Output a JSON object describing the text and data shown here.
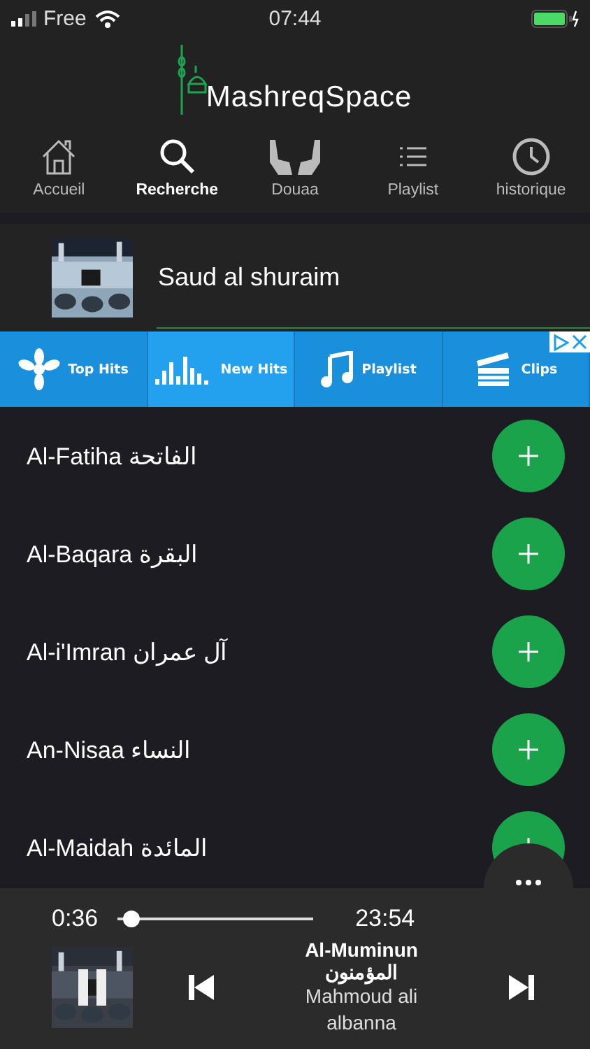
{
  "status_bar": {
    "carrier": "Free",
    "time": "07:44"
  },
  "logo": {
    "text": "MashreqSpace"
  },
  "nav": [
    {
      "label": "Accueil",
      "selected": false
    },
    {
      "label": "Recherche",
      "selected": true
    },
    {
      "label": "Douaa",
      "selected": false
    },
    {
      "label": "Playlist",
      "selected": false
    },
    {
      "label": "historique",
      "selected": false
    }
  ],
  "reciter": {
    "name": "Saud al shuraim"
  },
  "ad_banner": {
    "items": [
      {
        "label": "Top Hits",
        "selected": false
      },
      {
        "label": "New Hits",
        "selected": true
      },
      {
        "label": "Playlist",
        "selected": false
      },
      {
        "label": "Clips",
        "selected": false
      }
    ]
  },
  "surahs": [
    {
      "title": "Al-Fatiha الفاتحة"
    },
    {
      "title": "Al-Baqara البقرة"
    },
    {
      "title": "Al-i'Imran آل عمران"
    },
    {
      "title": "An-Nisaa النساء"
    },
    {
      "title": "Al-Maidah المائدة"
    }
  ],
  "player": {
    "elapsed": "0:36",
    "total": "23:54",
    "level": 0.03,
    "title": "Al-Muminun",
    "title_arabic": "المؤمنون",
    "artist": "Mahmoud ali albanna"
  }
}
